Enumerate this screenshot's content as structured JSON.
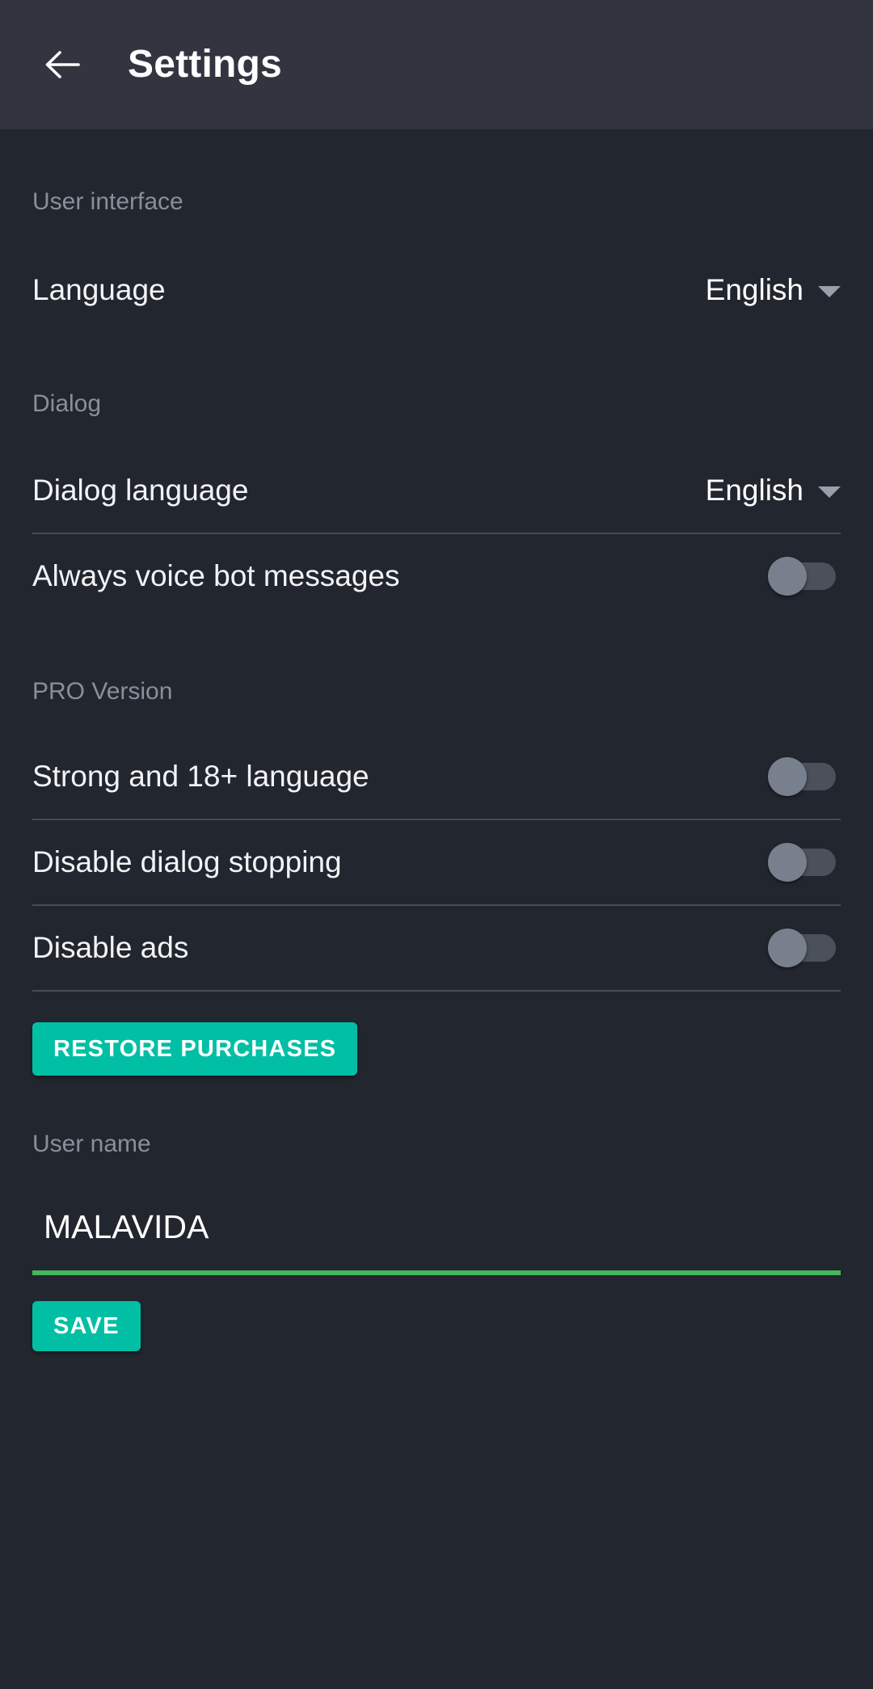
{
  "app": {
    "title": "Settings",
    "back_icon": "arrow-left-icon",
    "accent_color": "#00bfa5",
    "underline_color": "#43b75d",
    "header_bg": "#323540",
    "body_bg": "#22262e"
  },
  "sections": {
    "user_interface": {
      "header": "User interface",
      "language": {
        "label": "Language",
        "value": "English",
        "caret_icon": "chevron-down-icon"
      }
    },
    "dialog": {
      "header": "Dialog",
      "dialog_language": {
        "label": "Dialog language",
        "value": "English",
        "caret_icon": "chevron-down-icon"
      },
      "always_voice": {
        "label": "Always voice bot messages",
        "state": "off"
      }
    },
    "pro_version": {
      "header": "PRO Version",
      "strong_language": {
        "label": "Strong and 18+ language",
        "state": "off"
      },
      "disable_dialog_stopping": {
        "label": "Disable dialog stopping",
        "state": "off"
      },
      "disable_ads": {
        "label": "Disable ads",
        "state": "off"
      },
      "restore_button": "RESTORE PURCHASES"
    },
    "user_name": {
      "header": "User name",
      "value": "MALAVIDA",
      "placeholder": "User name",
      "save_button": "SAVE"
    }
  }
}
